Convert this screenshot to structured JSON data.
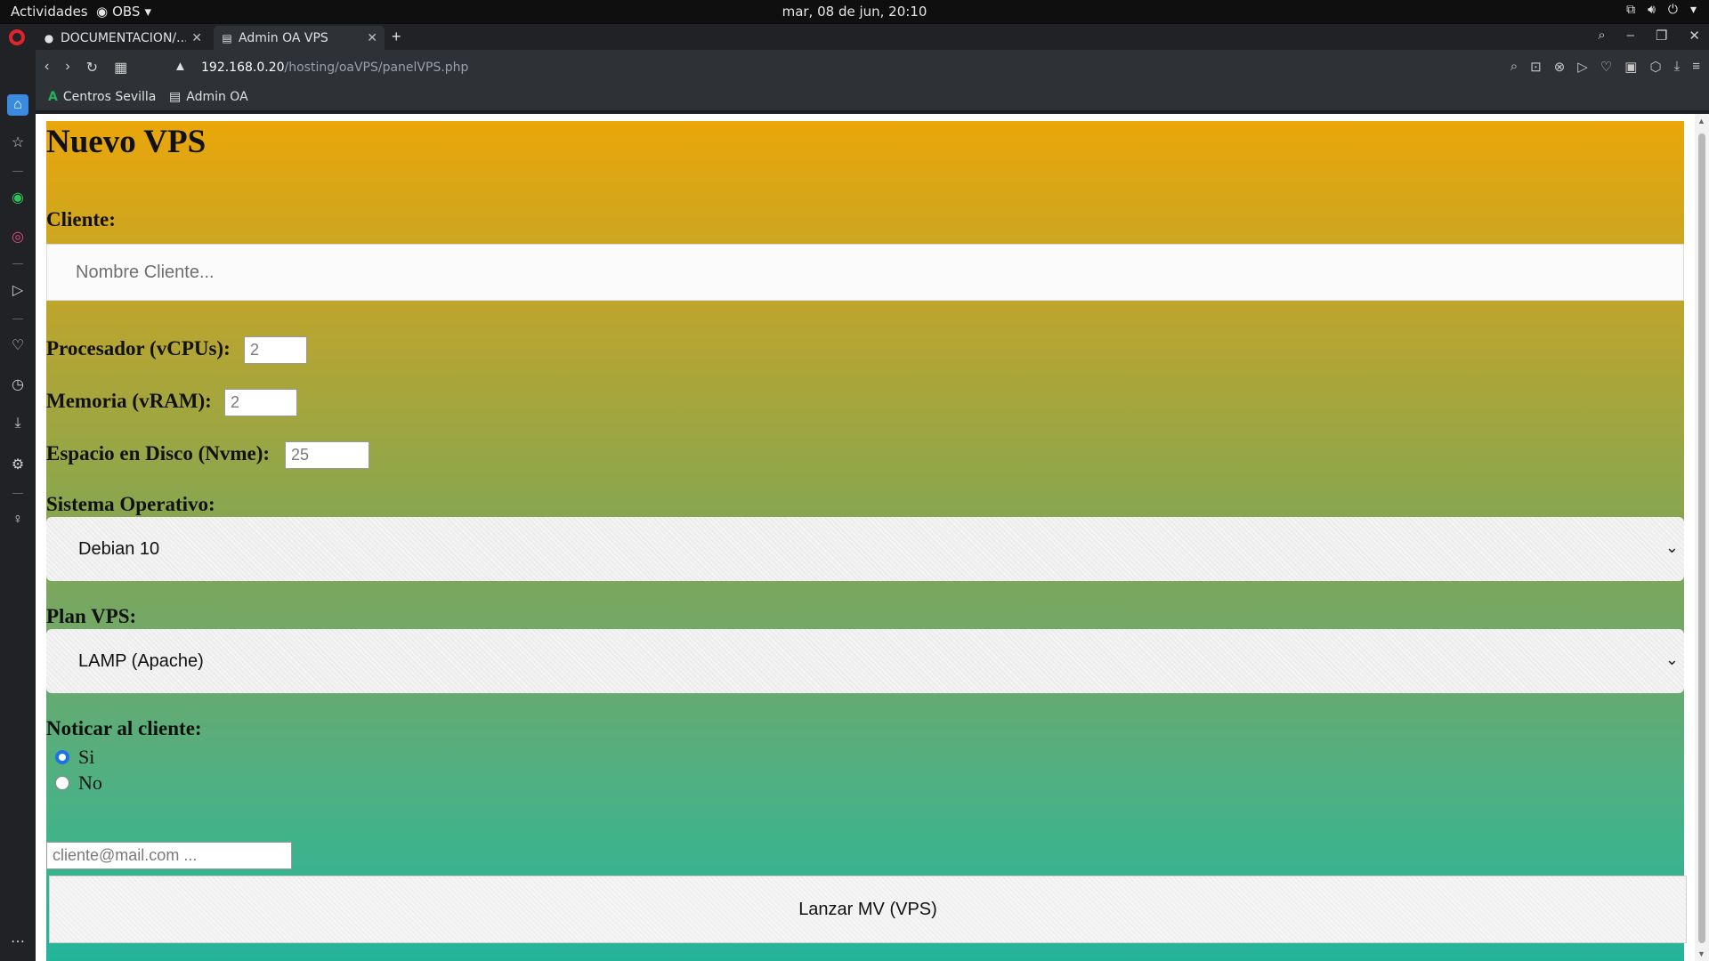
{
  "topbar": {
    "activities": "Actividades",
    "obs": "OBS",
    "clock": "mar, 08 de jun, 20:10"
  },
  "tabs": [
    {
      "label": "DOCUMENTACION/...",
      "icon": "github-icon"
    },
    {
      "label": "Admin OA VPS",
      "icon": "page-icon",
      "active": true
    }
  ],
  "address": {
    "host": "192.168.0.20",
    "path": "/hosting/oaVPS/panelVPS.php"
  },
  "bookmarks": [
    {
      "label": "Centros Sevilla",
      "icon": "andalucia-icon"
    },
    {
      "label": "Admin OA",
      "icon": "page-icon"
    }
  ],
  "form": {
    "title": "Nuevo VPS",
    "client_label": "Cliente:",
    "client_placeholder": "Nombre Cliente...",
    "cpu_label": "Procesador (vCPUs):",
    "cpu_value": "2",
    "ram_label": "Memoria (vRAM):",
    "ram_value": "2",
    "disk_label": "Espacio en Disco (Nvme):",
    "disk_value": "25",
    "os_label": "Sistema Operativo:",
    "os_selected": "Debian 10",
    "plan_label": "Plan VPS:",
    "plan_selected": "LAMP (Apache)",
    "notify_label": "Noticar al cliente:",
    "notify_yes": "Si",
    "notify_no": "No",
    "notify_selected": "Si",
    "email_placeholder": "cliente@mail.com ...",
    "submit_label": "Lanzar MV (VPS)"
  },
  "colors": {
    "gradient_top": "#eaa60a",
    "gradient_bottom": "#21b49c",
    "radio_accent": "#1a73e8"
  }
}
